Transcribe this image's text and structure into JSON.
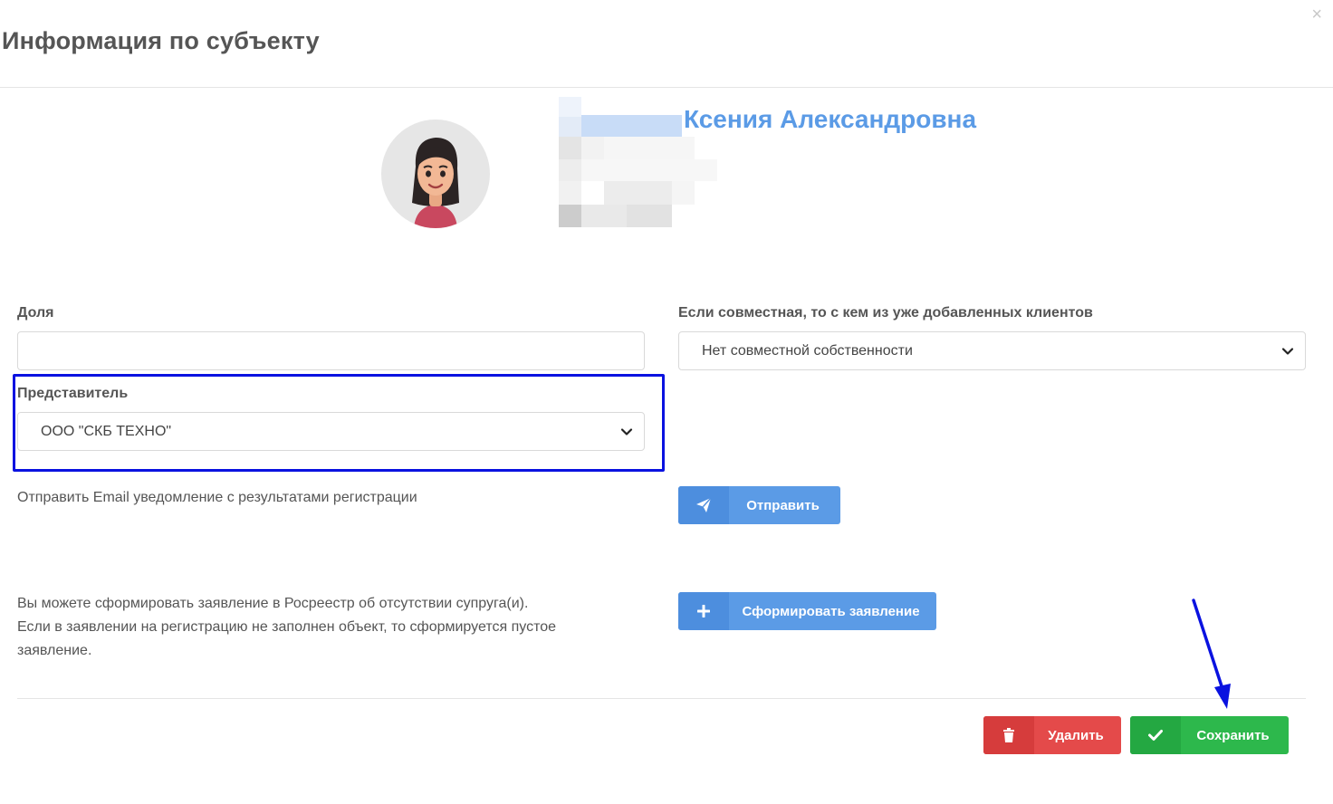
{
  "modal": {
    "title": "Информация по субъекту",
    "close_glyph": "×"
  },
  "subject": {
    "name": "Ксения Александровна",
    "avatar_icon": "woman-avatar-icon"
  },
  "form": {
    "share": {
      "label": "Доля",
      "value": ""
    },
    "joint": {
      "label": "Если совместная, то с кем из уже добавленных клиентов",
      "selected": "Нет совместной собственности"
    },
    "representative": {
      "label": "Представитель",
      "selected": "ООО \"СКБ ТЕХНО\""
    }
  },
  "email_notice": {
    "text": "Отправить Email уведомление с результатами регистрации",
    "button_label": "Отправить",
    "button_icon": "paper-plane-icon"
  },
  "statement": {
    "line1": "Вы можете сформировать заявление в Росреестр об отсутствии супруга(и).",
    "line2": "Если в заявлении на регистрацию не заполнен объект, то сформируется пустое",
    "line3": "заявление.",
    "button_label": "Сформировать заявление",
    "button_icon": "plus-icon"
  },
  "footer": {
    "delete_label": "Удалить",
    "delete_icon": "trash-icon",
    "save_label": "Сохранить",
    "save_icon": "check-icon"
  },
  "colors": {
    "accent_blue": "#5b9be6",
    "danger_red": "#e44a4a",
    "success_green": "#2db84c",
    "annotation_blue": "#0a12e0"
  }
}
